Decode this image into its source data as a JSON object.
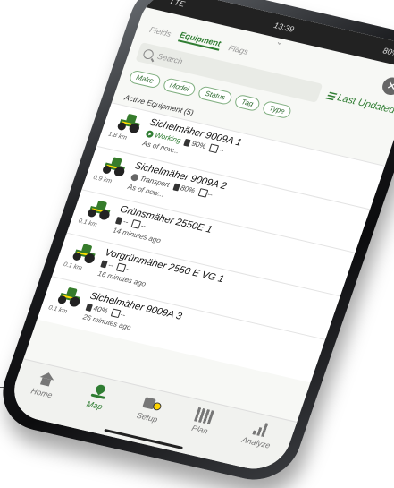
{
  "status_bar": {
    "network": "LTE",
    "time": "13:39",
    "battery": "80%"
  },
  "tabs": [
    {
      "label": "Fields",
      "active": false
    },
    {
      "label": "Equipment",
      "active": true
    },
    {
      "label": "Flags",
      "active": false
    }
  ],
  "search": {
    "placeholder": "Search"
  },
  "sort": {
    "label": "Last Updated"
  },
  "filters": [
    "Make",
    "Model",
    "Status",
    "Tag",
    "Type"
  ],
  "section_title": "Active Equipment (5)",
  "equipment": [
    {
      "name": "Sichelmäher 9009A 1",
      "status": "Working",
      "fuel": "90%",
      "def": "--",
      "distance": "1.8 km",
      "time": "As of now..."
    },
    {
      "name": "Sichelmäher 9009A 2",
      "status": "Transport",
      "fuel": "80%",
      "def": "--",
      "distance": "0.9 km",
      "time": "As of now..."
    },
    {
      "name": "Grünsmäher 2550E 1",
      "status": "",
      "fuel": "--",
      "def": "--",
      "distance": "0.1 km",
      "time": "14 minutes ago"
    },
    {
      "name": "Vorgrünmäher 2550 E VG 1",
      "status": "",
      "fuel": "--",
      "def": "--",
      "distance": "0.1 km",
      "time": "16 minutes ago"
    },
    {
      "name": "Sichelmäher 9009A 3",
      "status": "",
      "fuel": "40%",
      "def": "--",
      "distance": "0.1 km",
      "time": "26 minutes ago"
    }
  ],
  "nav": [
    {
      "label": "Home",
      "active": false
    },
    {
      "label": "Map",
      "active": true
    },
    {
      "label": "Setup",
      "active": false
    },
    {
      "label": "Plan",
      "active": false
    },
    {
      "label": "Analyze",
      "active": false
    }
  ],
  "colors": {
    "accent": "#2f7d32",
    "brand_yellow": "#ffde00"
  }
}
